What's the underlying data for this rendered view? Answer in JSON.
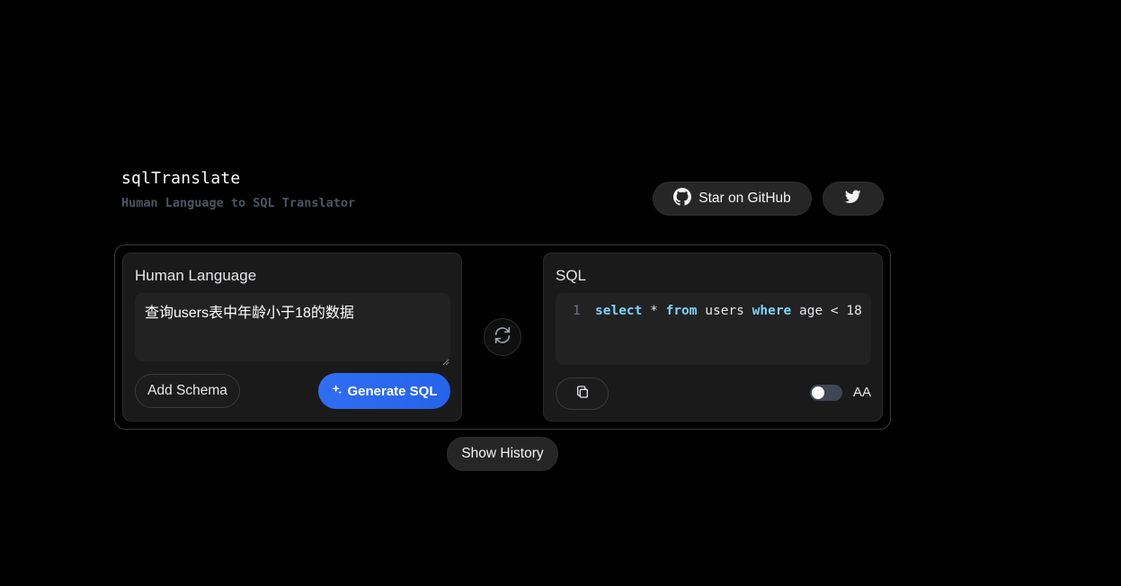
{
  "brand": {
    "title": "sqlTranslate",
    "subtitle": "Human Language to SQL Translator"
  },
  "header": {
    "github_label": "Star on GitHub",
    "github_icon": "github-icon",
    "twitter_icon": "twitter-icon"
  },
  "human_panel": {
    "title": "Human Language",
    "input_value": "查询users表中年龄小于18的数据",
    "add_schema_label": "Add Schema",
    "generate_label": "Generate SQL",
    "generate_icon": "sparkles-icon"
  },
  "swap": {
    "icon": "swap-arrows-icon"
  },
  "sql_panel": {
    "title": "SQL",
    "line_number": "1",
    "code_tokens": [
      {
        "text": "select",
        "type": "keyword"
      },
      {
        "text": " * ",
        "type": "plain"
      },
      {
        "text": "from",
        "type": "keyword"
      },
      {
        "text": " users ",
        "type": "plain"
      },
      {
        "text": "where",
        "type": "keyword"
      },
      {
        "text": " age < 18",
        "type": "plain"
      }
    ],
    "copy_icon": "copy-icon",
    "toggle_on": false,
    "toggle_label": "AA"
  },
  "history": {
    "label": "Show History"
  },
  "colors": {
    "background": "#000000",
    "accent": "#2563eb",
    "keyword": "#7dd3fc"
  }
}
